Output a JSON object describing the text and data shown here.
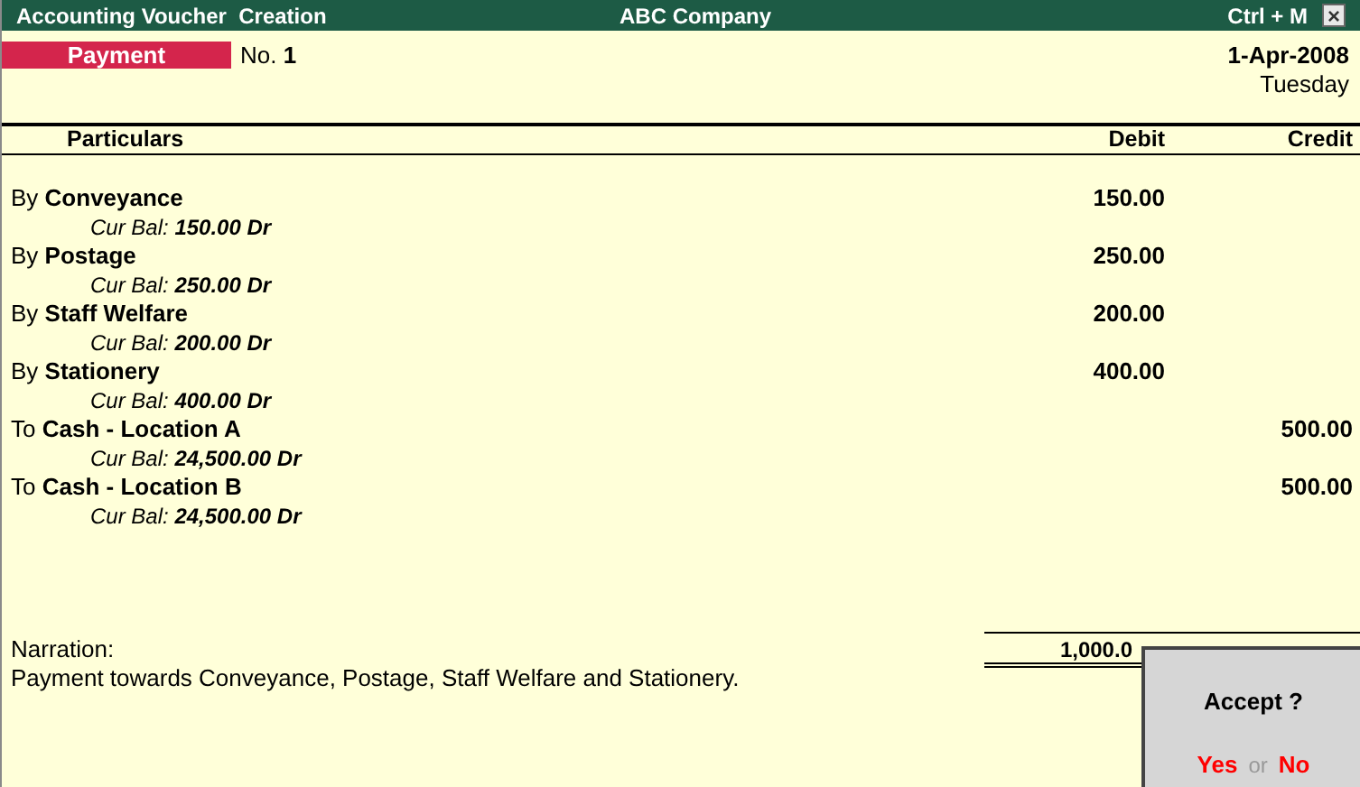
{
  "title_bar": {
    "left": "Accounting Voucher  Creation",
    "center": "ABC Company",
    "shortcut": "Ctrl + M",
    "close": "×"
  },
  "voucher": {
    "type": "Payment",
    "number_label": "No.",
    "number": "1",
    "date": "1-Apr-2008",
    "day": "Tuesday"
  },
  "table": {
    "columns": [
      "Particulars",
      "Debit",
      "Credit"
    ],
    "rows": [
      {
        "prefix": "By",
        "ledger": "Conveyance",
        "balance_label": "Cur Bal:",
        "balance": "150.00 Dr",
        "debit": "150.00",
        "credit": ""
      },
      {
        "prefix": "By",
        "ledger": "Postage",
        "balance_label": "Cur Bal:",
        "balance": "250.00 Dr",
        "debit": "250.00",
        "credit": ""
      },
      {
        "prefix": "By",
        "ledger": "Staff Welfare",
        "balance_label": "Cur Bal:",
        "balance": "200.00 Dr",
        "debit": "200.00",
        "credit": ""
      },
      {
        "prefix": "By",
        "ledger": "Stationery",
        "balance_label": "Cur Bal:",
        "balance": "400.00 Dr",
        "debit": "400.00",
        "credit": ""
      },
      {
        "prefix": "To",
        "ledger": "Cash - Location A",
        "balance_label": "Cur Bal:",
        "balance": "24,500.00 Dr",
        "debit": "",
        "credit": "500.00"
      },
      {
        "prefix": "To",
        "ledger": "Cash - Location B",
        "balance_label": "Cur Bal:",
        "balance": "24,500.00 Dr",
        "debit": "",
        "credit": "500.00"
      }
    ],
    "total_debit": "1,000.0"
  },
  "narration": {
    "label": "Narration:",
    "text": "Payment towards Conveyance, Postage, Staff Welfare and Stationery."
  },
  "dialog": {
    "question": "Accept ?",
    "yes": "Yes",
    "or": "or",
    "no": "No"
  }
}
